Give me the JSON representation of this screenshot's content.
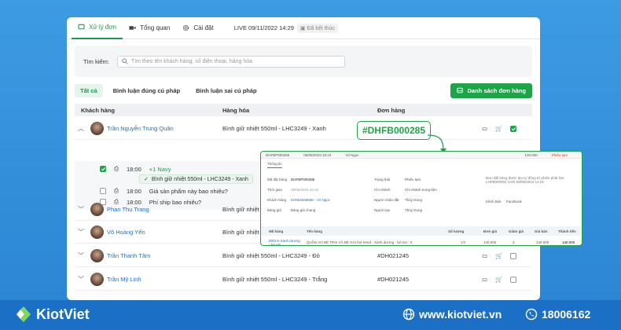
{
  "tabs": [
    {
      "label": "Xử lý đơn",
      "icon": "chat-icon"
    },
    {
      "label": "Tổng quan",
      "icon": "video-icon"
    },
    {
      "label": "Cài đặt",
      "icon": "gear-icon"
    }
  ],
  "live": {
    "text": "LIVE 09/11/2022 14:29",
    "status": "Đã kết thúc"
  },
  "search": {
    "label": "Tìm kiếm:",
    "placeholder": "Tìm theo tên khách hàng, số điện thoại, hàng hóa"
  },
  "filters": [
    "Tất cả",
    "Bình luận đúng cú pháp",
    "Bình luận sai cú pháp"
  ],
  "order_list_button": "Danh sách đơn hàng",
  "table_headers": {
    "customer": "Khách hàng",
    "product": "Hàng hóa",
    "order": "Đơn hàng"
  },
  "rows": [
    {
      "name": "Trần Nguyễn Trung Quân",
      "product": "Bình giữ nhiệt 550ml - LHC3249 - Xanh",
      "order": ""
    },
    {
      "name": "Phan Thu Trang",
      "product": "Bình giữ nhiệt 55",
      "order": ""
    },
    {
      "name": "Võ Hoàng Yến",
      "product": "Bình giữ nhiệt 55",
      "order": ""
    },
    {
      "name": "Trần Thanh Tâm",
      "product": "Bình giữ nhiệt 550ml - LHC3249 - Đỏ",
      "order": "#DH021245"
    },
    {
      "name": "Trần Mỹ Linh",
      "product": "Bình giữ nhiệt 550ml - LHC3249 - Trắng",
      "order": "#DH021245"
    }
  ],
  "comments": [
    {
      "time": "18:00",
      "text": "+1 Navy",
      "chip": "Bình giữ nhiệt 550ml - LHC3249 - Xanh"
    },
    {
      "time": "18:00",
      "text": "Giá sản phẩm này bao nhiêu?"
    },
    {
      "time": "18:00",
      "text": "Phí ship bao nhiêu?"
    }
  ],
  "highlight_order": "#DHFB000285",
  "popup": {
    "header": [
      "DHFBP000285",
      "09/05/2023 15:10",
      "Võ Ngọc",
      "120.000",
      "Phiếu tạm"
    ],
    "tab": "Thông tin",
    "fields_left": [
      {
        "label": "Mã đặt hàng",
        "value": "DHFBP000285"
      },
      {
        "label": "Thời gian",
        "value": "09/05/2023 15:10"
      },
      {
        "label": "Khách hàng",
        "value": "KH554548688 - Võ Ngọc"
      },
      {
        "label": "Bảng giá",
        "value": "Bảng giá chung"
      }
    ],
    "fields_mid": [
      {
        "label": "Trạng thái",
        "value": "Phiếu tạm"
      },
      {
        "label": "Chi nhánh",
        "value": "Chi nhánh trung tâm"
      },
      {
        "label": "Người nhận đặt",
        "value": "Thùy Dung"
      },
      {
        "label": "Người tạo",
        "value": "Thùy Dung"
      }
    ],
    "note": "Đơn đặt hàng được tạo tự động từ phiên phát live LHFB000002 LIVE 09/05/2023 14:24",
    "channel_label": "Kênh bán:",
    "channel": "Facebook",
    "table_headers": [
      "Mã hàng",
      "Tên hàng",
      "Số lượng",
      "Đơn giá",
      "Giảm giá",
      "Giá bán",
      "Thành tiền"
    ],
    "item": {
      "code": "0001X-Xanh dương - bé gái",
      "name": "QUẦN ÁO BÉ TRAI VÀ BÉ GÁI hot trend - Xanh dương - bé trai - S",
      "qty": "1/0",
      "price": "140.000",
      "discount": "3",
      "sale": "140.000",
      "total": "140.000"
    }
  },
  "footer": {
    "brand": "KiotViet",
    "website": "www.kiotviet.vn",
    "phone": "18006162"
  }
}
